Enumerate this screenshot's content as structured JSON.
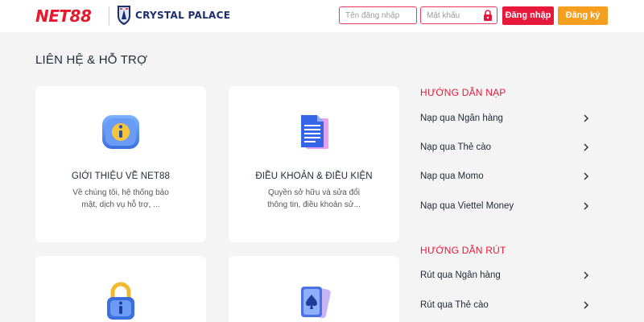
{
  "header": {
    "logo_text": "NET88",
    "partner_text": "CRYSTAL PALACE",
    "username_placeholder": "Tên đăng nhập",
    "password_placeholder": "Mật khẩu",
    "login_label": "Đăng nhập",
    "register_label": "Đăng ký"
  },
  "page": {
    "title": "LIÊN HỆ & HỖ TRỢ"
  },
  "cards": [
    {
      "title": "GIỚI THIỆU VỀ NET88",
      "description": "Về chúng tôi, hệ thống bảo mật, dịch vụ hỗ trợ, ...",
      "icon": "info-chat-icon"
    },
    {
      "title": "ĐIỀU KHOẢN & ĐIỀU KIỆN",
      "description": "Quyền sở hữu và sửa đổi thông tin, điều khoản sử...",
      "icon": "document-icon"
    },
    {
      "title": "",
      "description": "",
      "icon": "lock-info-icon"
    },
    {
      "title": "",
      "description": "",
      "icon": "playing-cards-icon"
    }
  ],
  "sidebar": {
    "deposit_title": "HƯỚNG DẪN NẠP",
    "deposit_items": [
      "Nạp qua Ngân hàng",
      "Nạp qua Thẻ cào",
      "Nạp qua Momo",
      "Nạp qua Viettel Money"
    ],
    "withdraw_title": "HƯỚNG DẪN RÚT",
    "withdraw_items": [
      "Rút qua Ngân hàng",
      "Rút qua Thẻ cào"
    ]
  },
  "colors": {
    "brand_red": "#e6183c",
    "register_orange": "#f59f1e",
    "partner_navy": "#1b2e6e",
    "background": "#f4f4f4"
  }
}
